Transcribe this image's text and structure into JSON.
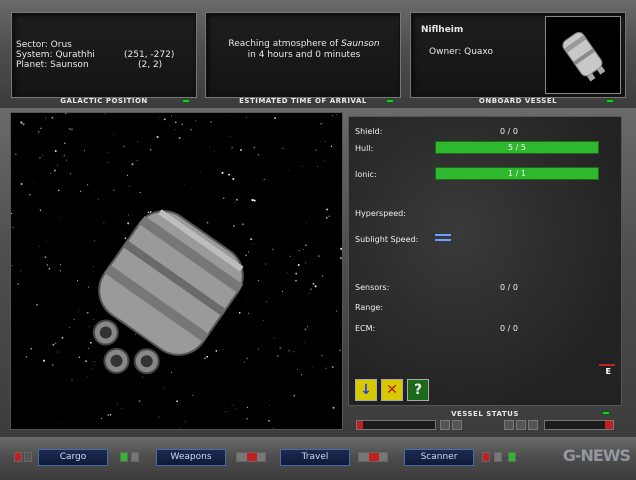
{
  "galactic_position": {
    "caption": "GALACTIC POSITION",
    "sector_line": "Sector: Orus",
    "system_line": "System: Qurathhi",
    "system_coords": "(251, -272)",
    "planet_line": "Planet: Saunson",
    "planet_coords": "(2, 2)"
  },
  "eta": {
    "caption": "ESTIMATED TIME OF ARRIVAL",
    "line1_prefix": "Reaching atmosphere of ",
    "destination": "Saunson",
    "line2": "in 4 hours and 0 minutes"
  },
  "onboard_vessel": {
    "caption": "ONBOARD VESSEL",
    "name": "Niflheim",
    "owner": "Owner: Quaxo"
  },
  "vessel_status": {
    "caption": "VESSEL STATUS",
    "shield_label": "Shield:",
    "shield_value": "0 / 0",
    "hull_label": "Hull:",
    "hull_value": "5 / 5",
    "hull_fraction": 1.0,
    "ionic_label": "Ionic:",
    "ionic_value": "1 / 1",
    "ionic_fraction": 1.0,
    "hyperspeed_label": "Hyperspeed:",
    "sublight_label": "Sublight Speed:",
    "sensors_label": "Sensors:",
    "sensors_value": "0 / 0",
    "range_label": "Range:",
    "ecm_label": "ECM:",
    "ecm_value": "0 / 0",
    "e_tag": "E",
    "icons": [
      "down-arrow-icon",
      "unload-icon",
      "help-icon"
    ]
  },
  "bottom_bar": {
    "cargo": "Cargo",
    "weapons": "Weapons",
    "travel": "Travel",
    "scanner": "Scanner"
  },
  "watermark": "G-NEWS",
  "colors": {
    "bar_green": "#2db82d",
    "led_green": "#22cc33",
    "button_blue": "#1a2a52"
  }
}
